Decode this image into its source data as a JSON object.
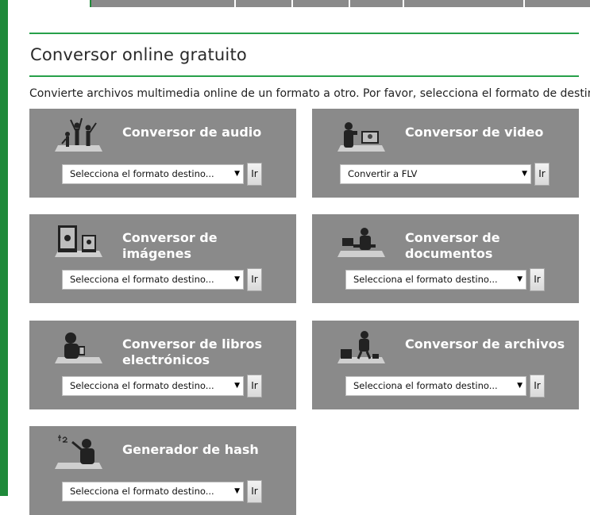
{
  "title": "Conversor online gratuito",
  "intro": "Convierte archivos multimedia online de un formato a otro. Por favor, selecciona el formato de destino:",
  "go_label": "Ir",
  "converters": [
    {
      "title": "Conversor de audio",
      "selected": "Selecciona el formato destino...",
      "icon": "dancing-people-icon"
    },
    {
      "title": "Conversor de video",
      "selected": "Convertir a FLV",
      "icon": "video-camera-icon"
    },
    {
      "title": "Conversor de imágenes",
      "selected": "Selecciona el formato destino...",
      "icon": "photo-frames-icon"
    },
    {
      "title": "Conversor de documentos",
      "selected": "Selecciona el formato destino...",
      "icon": "office-worker-icon"
    },
    {
      "title": "Conversor de libros electrónicos",
      "selected": "Selecciona el formato destino...",
      "icon": "ebook-reader-icon"
    },
    {
      "title": "Conversor de archivos",
      "selected": "Selecciona el formato destino...",
      "icon": "archive-box-icon"
    },
    {
      "title": "Generador de hash",
      "selected": "Selecciona el formato destino...",
      "icon": "hash-writer-icon"
    }
  ]
}
